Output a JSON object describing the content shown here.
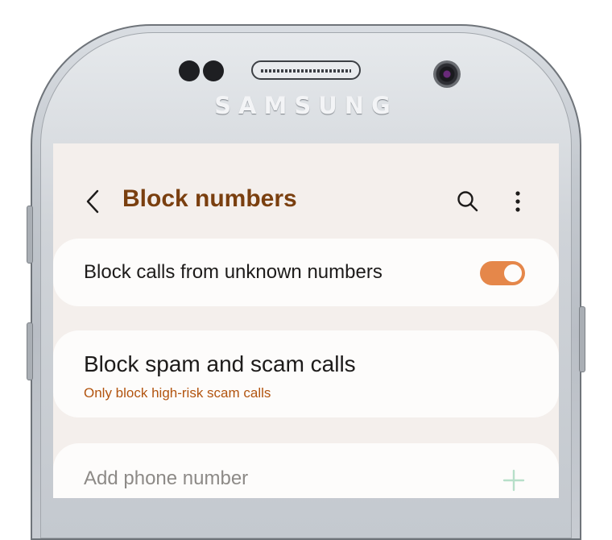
{
  "device": {
    "brand": "SAMSUNG"
  },
  "colors": {
    "accent": "#e5874a",
    "title": "#7a3f0f",
    "subtitle": "#b2540f",
    "screen_bg": "#f4efec",
    "card_bg": "#fdfcfb"
  },
  "appbar": {
    "title": "Block numbers",
    "back_icon": "chevron-left-icon",
    "search_icon": "search-icon",
    "more_icon": "more-vertical-icon"
  },
  "settings": {
    "unknown_numbers": {
      "label": "Block calls from unknown numbers",
      "enabled": true
    },
    "spam_calls": {
      "label": "Block spam and scam calls",
      "sublabel": "Only block high-risk scam calls"
    },
    "add_number": {
      "placeholder": "Add phone number",
      "add_icon": "plus-icon"
    }
  }
}
